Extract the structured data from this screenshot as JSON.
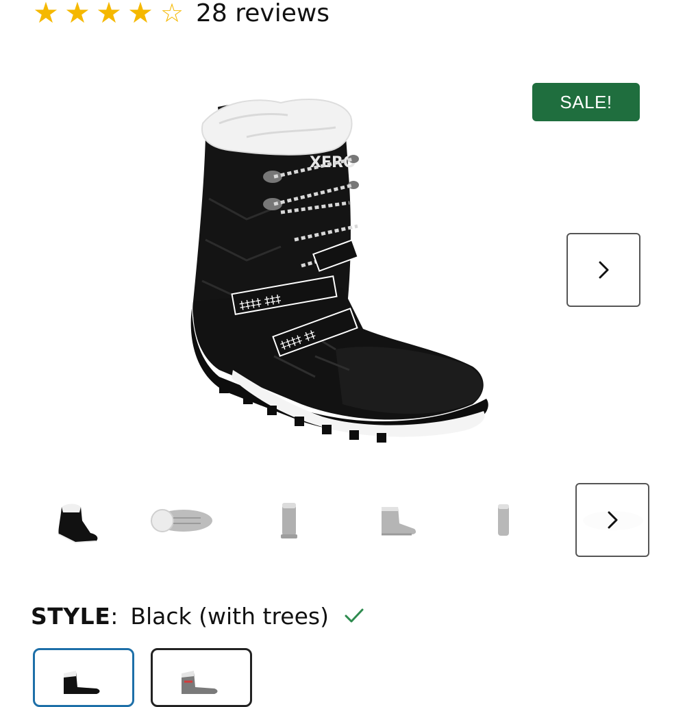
{
  "rating": {
    "stars_filled": 4,
    "stars_total": 5,
    "reviews_text": "28 reviews"
  },
  "gallery": {
    "sale_badge": "SALE!",
    "brand_logo": "XERO",
    "next_icon": "chevron-right-icon",
    "thumbnail_count": 6
  },
  "style": {
    "label": "STYLE",
    "colon": ":",
    "value": "Black (with trees)",
    "check_icon": "checkmark-icon"
  },
  "colors": {
    "sale_green": "#1f6e3e",
    "star_gold": "#f5b800",
    "selected_border": "#1d6fa8",
    "check_green": "#2e8b4f"
  }
}
